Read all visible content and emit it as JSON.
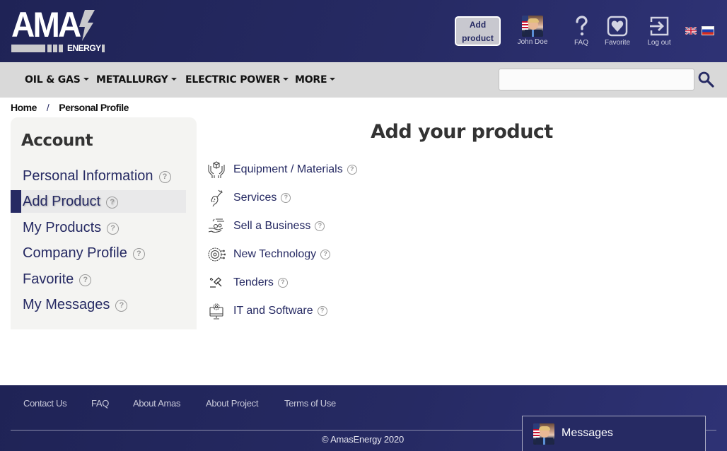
{
  "header": {
    "logo_text": "AMA",
    "logo_sub": "ENERGY",
    "add_product_line1": "Add",
    "add_product_line2": "product",
    "user_name": "John Doe",
    "faq_label": "FAQ",
    "favorite_label": "Favorite",
    "logout_label": "Log out",
    "languages": [
      "en",
      "ru"
    ]
  },
  "nav": {
    "items": [
      {
        "label": "OIL & GAS"
      },
      {
        "label": "METALLURGY"
      },
      {
        "label": "ELECTRIC POWER"
      },
      {
        "label": "MORE"
      }
    ],
    "search_value": ""
  },
  "breadcrumb": {
    "home": "Home",
    "separator": "/",
    "current": "Personal Profile"
  },
  "sidebar": {
    "title": "Account",
    "items": [
      {
        "label": "Personal Information"
      },
      {
        "label": "Add Product",
        "active": true
      },
      {
        "label": "My Products"
      },
      {
        "label": "Company Profile"
      },
      {
        "label": "Favorite"
      },
      {
        "label": "My Messages"
      }
    ],
    "help_glyph": "?"
  },
  "main": {
    "title": "Add your product",
    "categories": [
      {
        "label": "Equipment / Materials",
        "icon": "box-in-hands-icon"
      },
      {
        "label": "Services",
        "icon": "hand-wrench-icon"
      },
      {
        "label": "Sell a Business",
        "icon": "hand-gears-icon"
      },
      {
        "label": "New Technology",
        "icon": "gear-circuit-icon"
      },
      {
        "label": "Tenders",
        "icon": "gavel-icon"
      },
      {
        "label": "IT and Software",
        "icon": "monitor-gear-icon"
      }
    ]
  },
  "footer": {
    "links": [
      "Contact Us",
      "FAQ",
      "About Amas",
      "About Project",
      "Terms of Use"
    ],
    "copyright": "© AmasEnergy 2020"
  },
  "messages": {
    "label": "Messages"
  },
  "colors": {
    "brand_navy": "#262a63",
    "nav_bg": "#d9d9d9",
    "sidebar_bg": "#f4f4f2"
  }
}
